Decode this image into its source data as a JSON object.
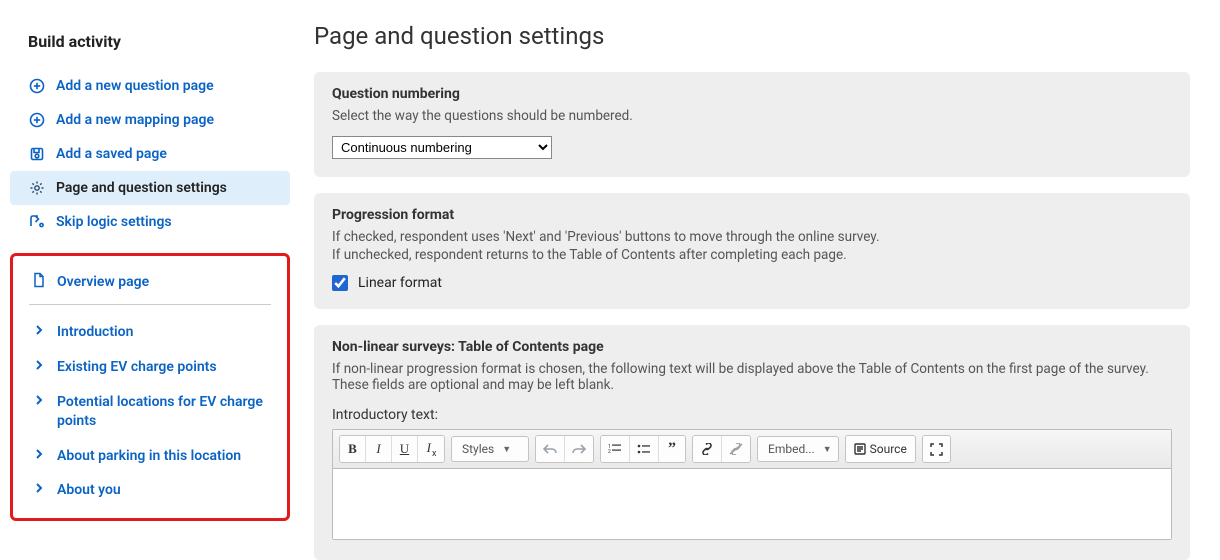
{
  "sidebar": {
    "title": "Build activity",
    "items": [
      {
        "label": "Add a new question page",
        "icon": "plus-circle"
      },
      {
        "label": "Add a new mapping page",
        "icon": "plus-circle"
      },
      {
        "label": "Add a saved page",
        "icon": "save"
      },
      {
        "label": "Page and question settings",
        "icon": "gear",
        "active": true
      },
      {
        "label": "Skip logic settings",
        "icon": "skip"
      }
    ],
    "overview_label": "Overview page",
    "pages": [
      {
        "label": "Introduction"
      },
      {
        "label": "Existing EV charge points"
      },
      {
        "label": "Potential locations for EV charge points"
      },
      {
        "label": "About parking in this location"
      },
      {
        "label": "About you"
      }
    ]
  },
  "main": {
    "title": "Page and question settings",
    "panels": {
      "numbering": {
        "heading": "Question numbering",
        "desc": "Select the way the questions should be numbered.",
        "select_value": "Continuous numbering"
      },
      "progression": {
        "heading": "Progression format",
        "line1": "If checked, respondent uses 'Next' and 'Previous' buttons to move through the online survey.",
        "line2": "If unchecked, respondent returns to the Table of Contents after completing each page.",
        "check_label": "Linear format",
        "checked": true
      },
      "toc": {
        "heading": "Non-linear surveys: Table of Contents page",
        "desc": "If non-linear progression format is chosen, the following text will be displayed above the Table of Contents on the first page of the survey. These fields are optional and may be left blank.",
        "field_label": "Introductory text:"
      }
    },
    "editor": {
      "bold": "B",
      "italic": "I",
      "underline": "U",
      "styles_label": "Styles",
      "embed_label": "Embed...",
      "source_label": "Source"
    }
  }
}
